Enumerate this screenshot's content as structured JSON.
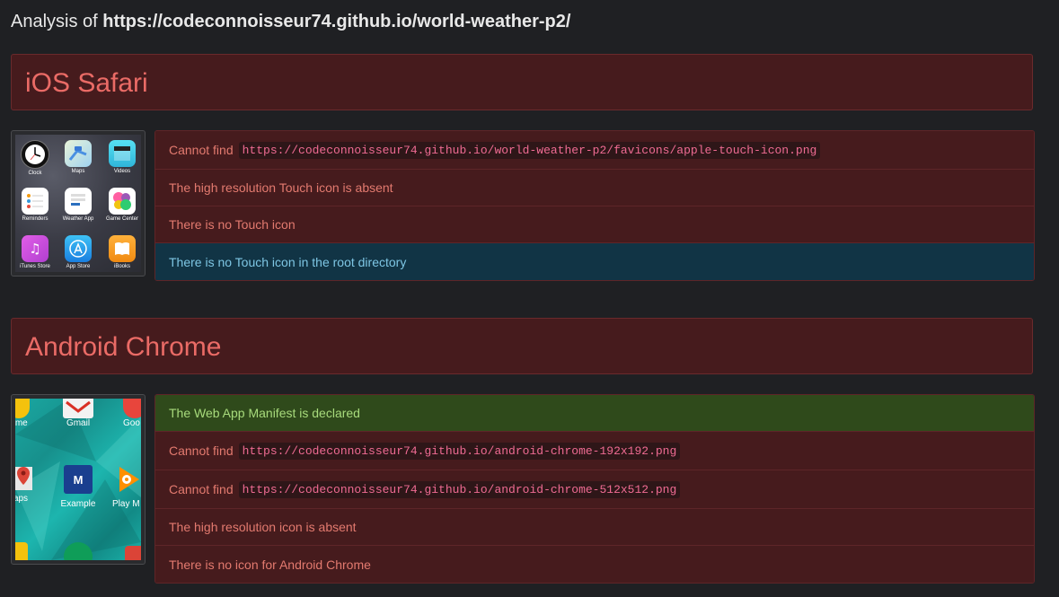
{
  "header": {
    "prefix": "Analysis of ",
    "url": "https://codeconnoisseur74.github.io/world-weather-p2/"
  },
  "sections": [
    {
      "title": "iOS Safari",
      "screenshot_apps": [
        {
          "label": "Clock",
          "icon": "clock-icon"
        },
        {
          "label": "Maps",
          "icon": "maps-icon"
        },
        {
          "label": "Videos",
          "icon": "videos-icon"
        },
        {
          "label": "Reminders",
          "icon": "reminders-icon"
        },
        {
          "label": "Weather App",
          "icon": "weather-app-icon"
        },
        {
          "label": "Game Center",
          "icon": "game-center-icon"
        },
        {
          "label": "iTunes Store",
          "icon": "itunes-store-icon"
        },
        {
          "label": "App Store",
          "icon": "app-store-icon"
        },
        {
          "label": "iBooks",
          "icon": "ibooks-icon"
        }
      ],
      "items": [
        {
          "status": "danger",
          "text": "Cannot find",
          "code": "https://codeconnoisseur74.github.io/world-weather-p2/favicons/apple-touch-icon.png"
        },
        {
          "status": "danger",
          "text": "The high resolution Touch icon is absent"
        },
        {
          "status": "danger",
          "text": "There is no Touch icon"
        },
        {
          "status": "info",
          "text": "There is no Touch icon in the root directory"
        }
      ]
    },
    {
      "title": "Android Chrome",
      "screenshot_apps": [
        {
          "label": "ome",
          "icon": "chrome-icon"
        },
        {
          "label": "Gmail",
          "icon": "gmail-icon"
        },
        {
          "label": "Goo",
          "icon": "google-icon"
        },
        {
          "label": "aps",
          "icon": "maps-pin-icon"
        },
        {
          "label": "Example",
          "icon": "example-app-icon",
          "glyph": "M"
        },
        {
          "label": "Play M",
          "icon": "play-music-icon"
        }
      ],
      "items": [
        {
          "status": "success",
          "text": "The Web App Manifest is declared"
        },
        {
          "status": "danger",
          "text": "Cannot find",
          "code": "https://codeconnoisseur74.github.io/android-chrome-192x192.png"
        },
        {
          "status": "danger",
          "text": "Cannot find",
          "code": "https://codeconnoisseur74.github.io/android-chrome-512x512.png"
        },
        {
          "status": "danger",
          "text": "The high resolution icon is absent"
        },
        {
          "status": "danger",
          "text": "There is no icon for Android Chrome"
        }
      ]
    }
  ],
  "colors": {
    "danger_bg": "#461b1d",
    "danger_text": "#e37a6f",
    "info_bg": "#113445",
    "info_text": "#7ec6e4",
    "success_bg": "#2f4a1b",
    "success_text": "#a8db7c",
    "code_text": "#ef6b93"
  }
}
